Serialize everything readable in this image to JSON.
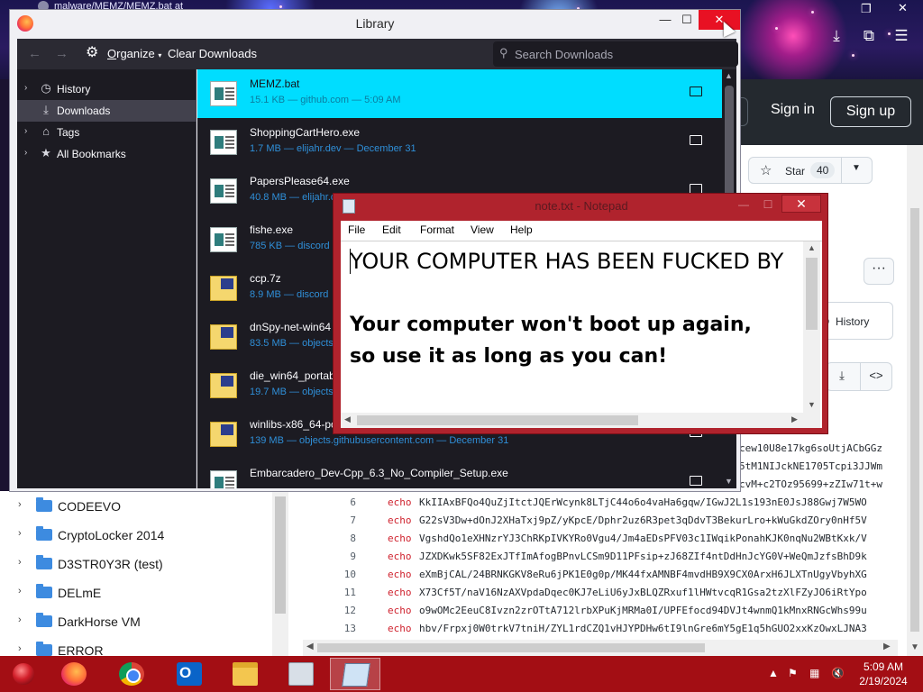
{
  "background": {
    "browser_tab_title": "malware/MEMZ/MEMZ.bat at",
    "github": {
      "sign_in": "Sign in",
      "sign_up": "Sign up",
      "star_label": "Star",
      "star_count": "40",
      "history_label": "History"
    },
    "code_lines": [
      {
        "n": "",
        "kw": "",
        "text": "cew10U8e17kg6soUtjACbGGz"
      },
      {
        "n": "",
        "kw": "",
        "text": "5tM1NIJckNE1705Tcpi3JJWm"
      },
      {
        "n": "",
        "kw": "",
        "text": "cvM+c2TOz95699+zZIw71t+w"
      },
      {
        "n": "6",
        "kw": "echo",
        "text": "KkIIAxBFQo4QuZjItctJQErWcynk8LTjC44o6o4vaHa6gqw/IGwJ2L1s193nE0JsJ88Gwj7W5WO"
      },
      {
        "n": "7",
        "kw": "echo",
        "text": "G22sV3Dw+dOnJ2XHaTxj9pZ/yKpcE/Dphr2uz6R3pet3qDdvT3BekurLro+kWuGkdZOry0nHf5V"
      },
      {
        "n": "8",
        "kw": "echo",
        "text": "VgshdQo1eXHNzrYJ3ChRKpIVKYRo0Vgu4/Jm4aEDsPFV03c1IWqikPonahKJK0nqNu2WBtKxk/V"
      },
      {
        "n": "9",
        "kw": "echo",
        "text": "JZXDKwk5SF82ExJTfImAfogBPnvLCSm9D11PFsip+zJ68ZIf4ntDdHnJcYG0V+WeQmJzfsBhD9k"
      },
      {
        "n": "10",
        "kw": "echo",
        "text": "eXmBjCAL/24BRNKGKV8eRu6jPK1E0g0p/MK44fxAMNBF4mvdHB9X9CX0ArxH6JLXTnUgyVbyhXG"
      },
      {
        "n": "11",
        "kw": "echo",
        "text": "X73Cf5T/naV16NzAXVpdaDqec0KJ7eLiU6yJxBLQZRxuf1lHWtvcqR1Gsa2tzXlFZyJO6iRtYpo"
      },
      {
        "n": "12",
        "kw": "echo",
        "text": "o9wOMc2EeuC8Ivzn2zrOTtA712lrbXPuKjMRMa0I/UPFEfocd94DVJt4wnmQ1kMnxRNGcWhs99u"
      },
      {
        "n": "13",
        "kw": "echo",
        "text": "hbv/Frpxj0W0trkV7tniH/ZYL1rdCZQ1vHJYPDHw6tI9lnGre6mY5gE1q5hGUO2xxKzOwxLJNA3"
      }
    ],
    "explorer_items": [
      "CODEEVO",
      "CryptoLocker 2014",
      "D3STR0Y3R (test)",
      "DELmE",
      "DarkHorse VM",
      "ERROR"
    ]
  },
  "library": {
    "title": "Library",
    "toolbar": {
      "organize_prefix": "O",
      "organize_rest": "rganize",
      "clear_downloads": "Clear Downloads",
      "search_placeholder": "Search Downloads"
    },
    "sidebar": [
      {
        "label": "History",
        "icon": "clock-icon",
        "expandable": true,
        "selected": false
      },
      {
        "label": "Downloads",
        "icon": "download-icon",
        "expandable": false,
        "selected": true
      },
      {
        "label": "Tags",
        "icon": "tag-icon",
        "expandable": true,
        "selected": false
      },
      {
        "label": "All Bookmarks",
        "icon": "star-icon",
        "expandable": true,
        "selected": false
      }
    ],
    "downloads": [
      {
        "name": "MEMZ.bat",
        "meta": "15.1 KB — github.com — 5:09 AM",
        "type": "doc",
        "selected": true
      },
      {
        "name": "ShoppingCartHero.exe",
        "meta": "1.7 MB — elijahr.dev — December 31",
        "type": "doc",
        "selected": false
      },
      {
        "name": "PapersPlease64.exe",
        "meta": "40.8 MB — elijahr.dev",
        "type": "doc",
        "selected": false
      },
      {
        "name": "fishe.exe",
        "meta": "785 KB — discord",
        "type": "doc",
        "selected": false
      },
      {
        "name": "ccp.7z",
        "meta": "8.9 MB — discord",
        "type": "zip",
        "selected": false
      },
      {
        "name": "dnSpy-net-win64",
        "meta": "83.5 MB — objects",
        "type": "zip",
        "selected": false
      },
      {
        "name": "die_win64_portab",
        "meta": "19.7 MB — objects",
        "type": "zip",
        "selected": false
      },
      {
        "name": "winlibs-x86_64-po",
        "meta": "139 MB — objects.githubusercontent.com — December 31",
        "type": "zip",
        "selected": false
      },
      {
        "name": "Embarcadero_Dev-Cpp_6.3_No_Compiler_Setup.exe",
        "meta": "",
        "type": "doc",
        "selected": false
      }
    ]
  },
  "notepad": {
    "title": "note.txt - Notepad",
    "menu": [
      "File",
      "Edit",
      "Format",
      "View",
      "Help"
    ],
    "line1": "YOUR COMPUTER HAS BEEN FUCKED BY",
    "line2": "Your computer won't boot up again,",
    "line3": "so use it as long as you can!"
  },
  "taskbar": {
    "apps": [
      "firefox-icon",
      "chrome-icon",
      "outlook-icon",
      "file-explorer-icon",
      "system-tool-icon",
      "notepad-icon"
    ],
    "time": "5:09 AM",
    "date": "2/19/2024"
  },
  "colors": {
    "firefox_dark": "#1c1b22",
    "selected_download": "#00ddff",
    "notepad_frame": "#b0232d",
    "taskbar": "#a30e14",
    "close_red": "#e81123"
  }
}
